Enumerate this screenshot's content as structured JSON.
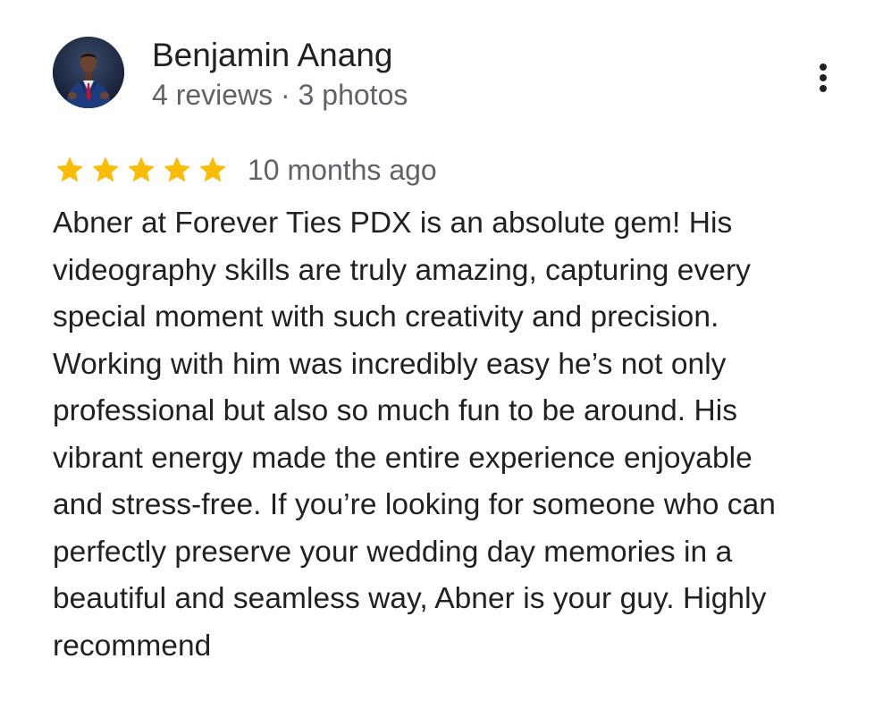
{
  "reviewer": {
    "name": "Benjamin Anang",
    "meta": "4 reviews · 3 photos",
    "avatar_icon": "person-avatar-photo"
  },
  "menu": {
    "icon": "more-vert-icon"
  },
  "review": {
    "rating": 5,
    "max_rating": 5,
    "star_color": "#fbbc04",
    "date": "10 months ago",
    "text": "Abner at Forever Ties PDX is an absolute gem! His\nvideography skills are truly amazing, capturing every\nspecial moment with such creativity and precision.\nWorking with him was incredibly easy he’s not only\nprofessional but also so much fun to be around. His\nvibrant energy made the entire experience enjoyable\nand stress-free. If you’re looking for someone who can\nperfectly preserve your wedding day memories in a\nbeautiful and seamless way, Abner is your guy. Highly\nrecommend"
  }
}
